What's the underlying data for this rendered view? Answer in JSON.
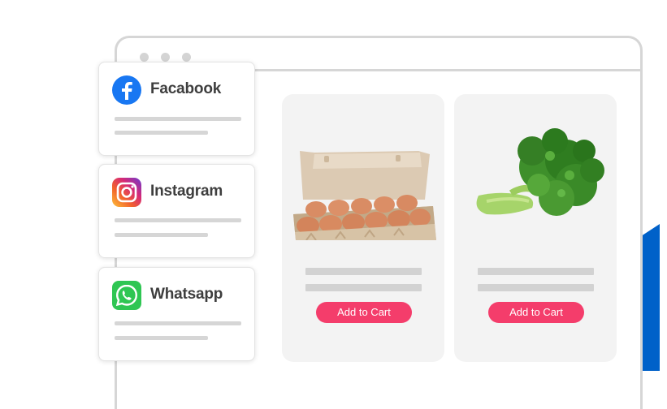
{
  "social_channels": [
    {
      "label": "Facabook",
      "icon": "facebook-icon",
      "color": "#1877f2"
    },
    {
      "label": "Instagram",
      "icon": "instagram-icon",
      "color": "#e1306c"
    },
    {
      "label": "Whatsapp",
      "icon": "whatsapp-icon",
      "color": "#25d366"
    }
  ],
  "products": [
    {
      "image": "egg-carton-image",
      "button_label": "Add to Cart"
    },
    {
      "image": "broccoli-image",
      "button_label": "Add to Cart"
    }
  ],
  "colors": {
    "accent_button": "#f43d6b",
    "brand_blue": "#0061c9",
    "frame_gray": "#d6d6d6"
  }
}
